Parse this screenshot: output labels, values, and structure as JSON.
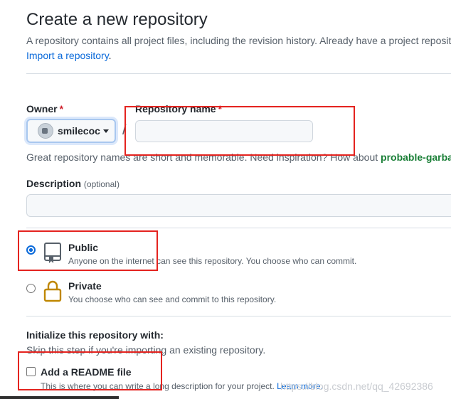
{
  "header": {
    "title": "Create a new repository",
    "subtitle": "A repository contains all project files, including the revision history. Already have a project reposit",
    "import_link": "Import a repository",
    "import_suffix": "."
  },
  "owner": {
    "label": "Owner",
    "required_mark": "*",
    "selected": "smilecoc"
  },
  "repo_name": {
    "label": "Repository name",
    "required_mark": "*",
    "value": "",
    "separator": "/"
  },
  "name_hint": {
    "text": "Great repository names are short and memorable. Need inspiration? How about ",
    "suggestion": "probable-garbar"
  },
  "description": {
    "label": "Description",
    "optional": "(optional)",
    "value": ""
  },
  "visibility": {
    "selected": "public",
    "options": [
      {
        "id": "public",
        "title": "Public",
        "desc": "Anyone on the internet can see this repository. You choose who can commit."
      },
      {
        "id": "private",
        "title": "Private",
        "desc": "You choose who can see and commit to this repository."
      }
    ]
  },
  "initialize": {
    "heading": "Initialize this repository with:",
    "hint": "Skip this step if you're importing an existing repository.",
    "readme_label": "Add a README file",
    "readme_checked": false,
    "readme_desc": "This is where you can write a long description for your project. ",
    "learn_more": "Learn more."
  },
  "watermark": "https://blog.csdn.net/qq_42692386",
  "annotation_color": "#e4231f"
}
